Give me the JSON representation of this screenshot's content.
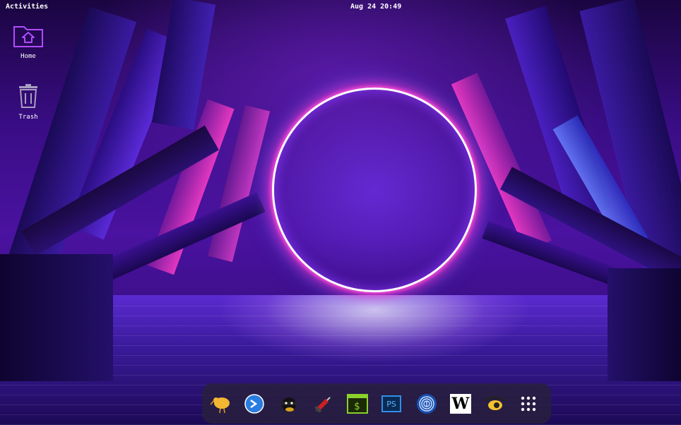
{
  "topbar": {
    "activities": "Activities",
    "clock": "Aug 24 20:49"
  },
  "desktop": {
    "icons": [
      {
        "label": "Home",
        "icon": "home-folder-icon"
      },
      {
        "label": "Trash",
        "icon": "trash-icon"
      }
    ]
  },
  "dock": {
    "items": [
      {
        "icon": "kiwi-bird-icon"
      },
      {
        "icon": "nmap-blue-circle-icon"
      },
      {
        "icon": "masked-bandit-icon"
      },
      {
        "icon": "syringe-icon"
      },
      {
        "icon": "terminal-dollar-icon"
      },
      {
        "icon": "powershell-icon",
        "text": "PS"
      },
      {
        "icon": "fingerprint-icon"
      },
      {
        "icon": "wordpress-w-icon",
        "text": "W"
      },
      {
        "icon": "owl-eye-icon"
      },
      {
        "icon": "app-grid-icon"
      }
    ]
  },
  "colors": {
    "neon_pink": "#ff4fd8",
    "neon_blue": "#4a7dff",
    "dock_bg": "#28203c"
  }
}
